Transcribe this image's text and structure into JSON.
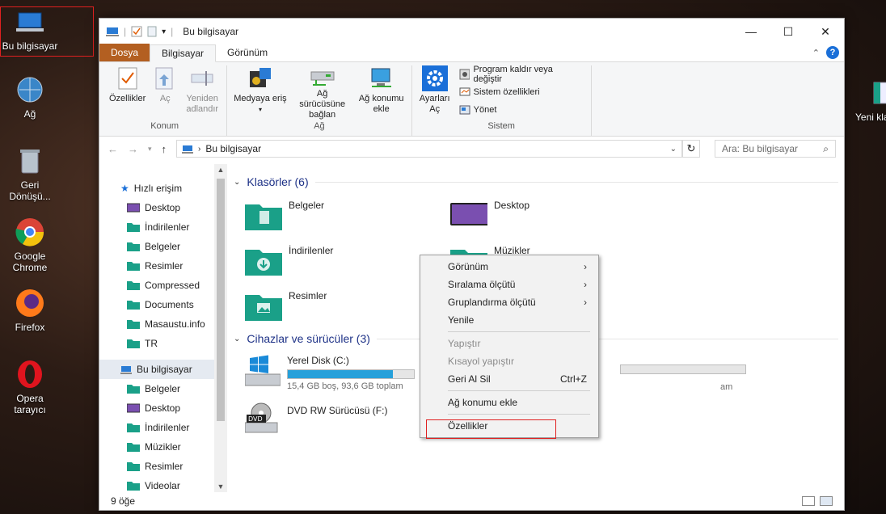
{
  "desktop": {
    "icons": [
      {
        "label": "Bu bilgisayar"
      },
      {
        "label": "Ağ"
      },
      {
        "label": "Geri Dönüşü..."
      },
      {
        "label": "Google Chrome"
      },
      {
        "label": "Firefox"
      },
      {
        "label": "Opera tarayıcı"
      }
    ],
    "right_icon_label": "Yeni kla"
  },
  "window": {
    "title": "Bu bilgisayar",
    "controls": {
      "minimize": "—",
      "maximize": "☐",
      "close": "✕"
    }
  },
  "tabs": {
    "file": "Dosya",
    "computer": "Bilgisayar",
    "view": "Görünüm"
  },
  "ribbon": {
    "konum": {
      "label": "Konum",
      "properties": "Özellikler",
      "open": "Aç",
      "rename": "Yeniden adlandır"
    },
    "ag": {
      "label": "Ağ",
      "media": "Medyaya eriş",
      "map_drive": "Ağ sürücüsüne bağlan",
      "add_location": "Ağ konumu ekle"
    },
    "sistem": {
      "label": "Sistem",
      "settings": "Ayarları Aç",
      "uninstall": "Program kaldır veya değiştir",
      "system_props": "Sistem özellikleri",
      "manage": "Yönet"
    }
  },
  "address": {
    "path": "Bu bilgisayar",
    "search_placeholder": "Ara: Bu bilgisayar"
  },
  "sidebar": {
    "quick_access": "Hızlı erişim",
    "quick_items": [
      {
        "label": "Desktop",
        "pinned": true
      },
      {
        "label": "İndirilenler",
        "pinned": true
      },
      {
        "label": "Belgeler",
        "pinned": true
      },
      {
        "label": "Resimler",
        "pinned": true
      },
      {
        "label": "Compressed",
        "pinned": false
      },
      {
        "label": "Documents",
        "pinned": false
      },
      {
        "label": "Masaustu.info",
        "pinned": false
      },
      {
        "label": "TR",
        "pinned": false
      }
    ],
    "this_pc": "Bu bilgisayar",
    "pc_items": [
      "Belgeler",
      "Desktop",
      "İndirilenler",
      "Müzikler",
      "Resimler",
      "Videolar"
    ]
  },
  "content": {
    "folders_header": "Klasörler (6)",
    "folders": [
      "Belgeler",
      "Desktop",
      "İndirilenler",
      "Müzikler",
      "Resimler"
    ],
    "devices_header": "Cihazlar ve sürücüler (3)",
    "drive_c": {
      "name": "Yerel Disk (C:)",
      "free": "15,4 GB boş, 93,6 GB toplam",
      "used_fraction": 0.835
    },
    "drive_f": {
      "name": "DVD RW Sürücüsü (F:)"
    },
    "partial_text": "am"
  },
  "context_menu": {
    "items": [
      {
        "label": "Görünüm",
        "submenu": true
      },
      {
        "label": "Sıralama ölçütü",
        "submenu": true
      },
      {
        "label": "Gruplandırma ölçütü",
        "submenu": true
      },
      {
        "label": "Yenile"
      },
      {
        "label": "Yapıştır",
        "disabled": true
      },
      {
        "label": "Kısayol yapıştır",
        "disabled": true
      },
      {
        "label": "Geri Al Sil",
        "shortcut": "Ctrl+Z"
      },
      {
        "label": "Ağ konumu ekle"
      },
      {
        "label": "Özellikler"
      }
    ]
  },
  "status": {
    "count": "9 öğe"
  },
  "colors": {
    "accent": "#1e3287",
    "file_tab": "#b35f21",
    "highlight": "#e02020",
    "folder": "#1aa088"
  }
}
